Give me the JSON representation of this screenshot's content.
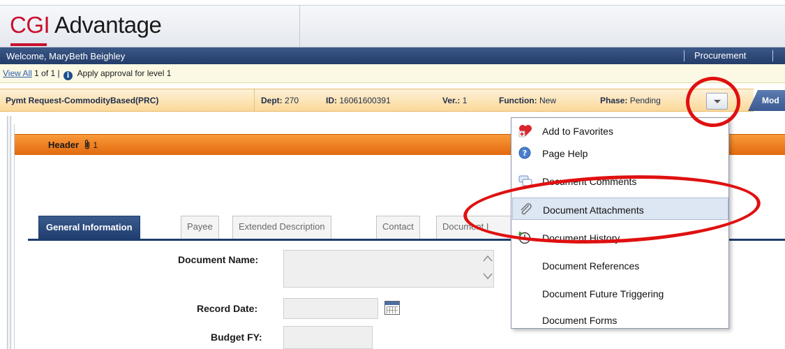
{
  "banner": {
    "logo_brand": "CGI",
    "logo_product": "Advantage"
  },
  "welcome_bar": {
    "welcome_text": "Welcome, MaryBeth Beighley",
    "module_link": "Procurement"
  },
  "approval_bar": {
    "view_all": "View All",
    "count_text": "1 of 1 |",
    "info_icon": "info-icon",
    "message": "Apply approval for level 1"
  },
  "document_bar": {
    "title": "Pymt Request-CommodityBased(PRC)",
    "dept_label": "Dept:",
    "dept_value": "270",
    "id_label": "ID:",
    "id_value": "16061600391",
    "ver_label": "Ver.:",
    "ver_value": "1",
    "function_label": "Function:",
    "function_value": "New",
    "phase_label": "Phase:",
    "phase_value": "Pending",
    "mode_tab_label": "Mod"
  },
  "header_section": {
    "title": "Header",
    "attachment_count": "1"
  },
  "tabs": [
    {
      "label": "General Information",
      "active": true
    },
    {
      "label": "Payee",
      "active": false
    },
    {
      "label": "Extended Description",
      "active": false
    },
    {
      "label": "Contact",
      "active": false
    },
    {
      "label": "Document I",
      "active": false
    }
  ],
  "form": {
    "document_name_label": "Document Name:",
    "record_date_label": "Record Date:",
    "budget_fy_label": "Budget FY:"
  },
  "dropdown_menu": {
    "items": [
      {
        "label": "Add to Favorites",
        "icon": "heart-plus-icon"
      },
      {
        "label": "Page Help",
        "icon": "help-icon"
      },
      {
        "label": "Document Comments",
        "icon": "comments-icon"
      },
      {
        "label": "Document Attachments",
        "icon": "paperclip-icon",
        "highlighted": true
      },
      {
        "label": "Document History",
        "icon": "history-icon"
      },
      {
        "label": "Document References",
        "icon": ""
      },
      {
        "label": "Document Future Triggering",
        "icon": ""
      },
      {
        "label": "Document Forms",
        "icon": ""
      }
    ]
  },
  "colors": {
    "brand_red": "#c8102e",
    "nav_blue": "#243d69",
    "header_orange": "#f08a2a",
    "annotation_red": "#e01010",
    "menu_highlight": "#dde6f3"
  }
}
